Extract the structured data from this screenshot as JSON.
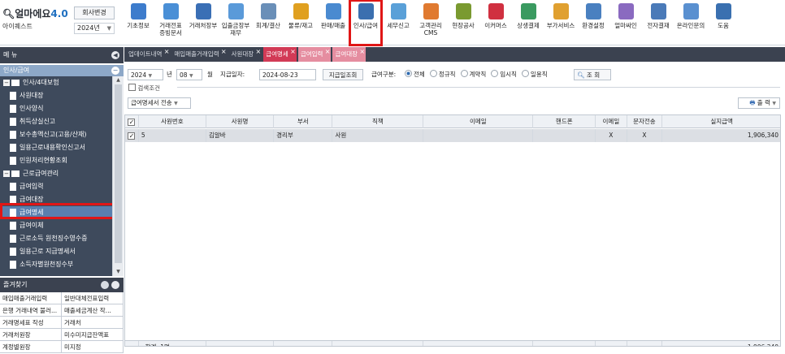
{
  "app": {
    "logo": "얼마에요",
    "version": "4.0",
    "company": "아이퀘스트",
    "change_btn": "회사변경",
    "year": "2024년"
  },
  "menu": [
    {
      "label": "기초정보",
      "color": "#3d7ccc"
    },
    {
      "label": "거래전표\n증빙문서",
      "color": "#4a8fd6"
    },
    {
      "label": "거래처장부",
      "color": "#3a6fb5"
    },
    {
      "label": "입출금장부\n재무",
      "color": "#5a9ad9"
    },
    {
      "label": "회계/결산",
      "color": "#6a8fb8"
    },
    {
      "label": "물류/재고",
      "color": "#e0a020"
    },
    {
      "label": "판매/매출",
      "color": "#4a8ad0"
    },
    {
      "label": "인사/급여",
      "color": "#3b6faf"
    },
    {
      "label": "세무신고",
      "color": "#5aa0d8"
    },
    {
      "label": "고객관리\nCMS",
      "color": "#e07a30"
    },
    {
      "label": "현장공사",
      "color": "#7a9a30"
    },
    {
      "label": "이커머스",
      "color": "#d03040"
    },
    {
      "label": "상생결제",
      "color": "#3a9a60"
    },
    {
      "label": "부가서비스",
      "color": "#e0a030"
    },
    {
      "label": "환경설정",
      "color": "#4a80c0"
    },
    {
      "label": "얼마싸인",
      "color": "#8a6ac0"
    },
    {
      "label": "전자결재",
      "color": "#4a7ab8"
    },
    {
      "label": "온라인문의",
      "color": "#5a90d0"
    },
    {
      "label": "도움",
      "color": "#3a70b0"
    }
  ],
  "sidebar": {
    "title": "메 뉴",
    "section": "인사/급여",
    "tree": [
      {
        "label": "인사/4대보험",
        "level": 0,
        "kind": "folder"
      },
      {
        "label": "사원대장",
        "level": 1,
        "kind": "doc"
      },
      {
        "label": "인사양식",
        "level": 1,
        "kind": "doc"
      },
      {
        "label": "취득상실신고",
        "level": 1,
        "kind": "doc"
      },
      {
        "label": "보수총액신고(고용/산재)",
        "level": 1,
        "kind": "doc"
      },
      {
        "label": "일용근로내용확인신고서",
        "level": 1,
        "kind": "doc"
      },
      {
        "label": "민원처리현황조회",
        "level": 1,
        "kind": "doc"
      },
      {
        "label": "근로급여관리",
        "level": 0,
        "kind": "folder"
      },
      {
        "label": "급여입력",
        "level": 1,
        "kind": "doc"
      },
      {
        "label": "급여대장",
        "level": 1,
        "kind": "doc"
      },
      {
        "label": "급여명세",
        "level": 1,
        "kind": "doc",
        "selected": true
      },
      {
        "label": "급여이체",
        "level": 1,
        "kind": "doc"
      },
      {
        "label": "근로소득 원천징수영수증",
        "level": 1,
        "kind": "doc"
      },
      {
        "label": "일용근로 지급명세서",
        "level": 1,
        "kind": "doc"
      },
      {
        "label": "소득자별원천징수부",
        "level": 1,
        "kind": "doc"
      }
    ],
    "fav_title": "즐겨찾기",
    "fav": [
      [
        "매입매출거래입력",
        "일반대체전표입력"
      ],
      [
        "은행 거래내역 불러...",
        "매출세금계산 작..."
      ],
      [
        "거래명세표 작성",
        "거래처"
      ],
      [
        "거래처원장",
        "미수미지급잔액표"
      ],
      [
        "계정별원장",
        "미지정"
      ]
    ]
  },
  "tabs": [
    {
      "label": "업데이트내역",
      "state": "normal"
    },
    {
      "label": "매입매출거래입력",
      "state": "normal"
    },
    {
      "label": "사원대장",
      "state": "normal"
    },
    {
      "label": "급여명세",
      "state": "active"
    },
    {
      "label": "급여입력",
      "state": "light"
    },
    {
      "label": "급여대장",
      "state": "light"
    }
  ],
  "filter": {
    "year": "2024",
    "year_unit": "년",
    "month": "08",
    "month_unit": "월",
    "pay_date_label": "지급일자:",
    "pay_date": "2024-08-23",
    "pay_date_btn": "지급일조회",
    "type_label": "급여구분:",
    "types": [
      "전체",
      "정규직",
      "계약직",
      "임시직",
      "일용직"
    ],
    "search_btn": "조 회",
    "cond_label": "검색조건",
    "send_btn": "급여명세서 전송",
    "print_btn": "출 력"
  },
  "grid": {
    "headers": [
      "사원번호",
      "사원명",
      "부서",
      "직책",
      "이메일",
      "핸드폰",
      "이메일",
      "문자전송",
      "실지급액"
    ],
    "rows": [
      [
        "5",
        "김알바",
        "경리부",
        "사원",
        "",
        "",
        "X",
        "X",
        "1,906,340"
      ]
    ],
    "footer": {
      "label": "합계",
      "count": "1명",
      "total": "1,906,340"
    }
  }
}
